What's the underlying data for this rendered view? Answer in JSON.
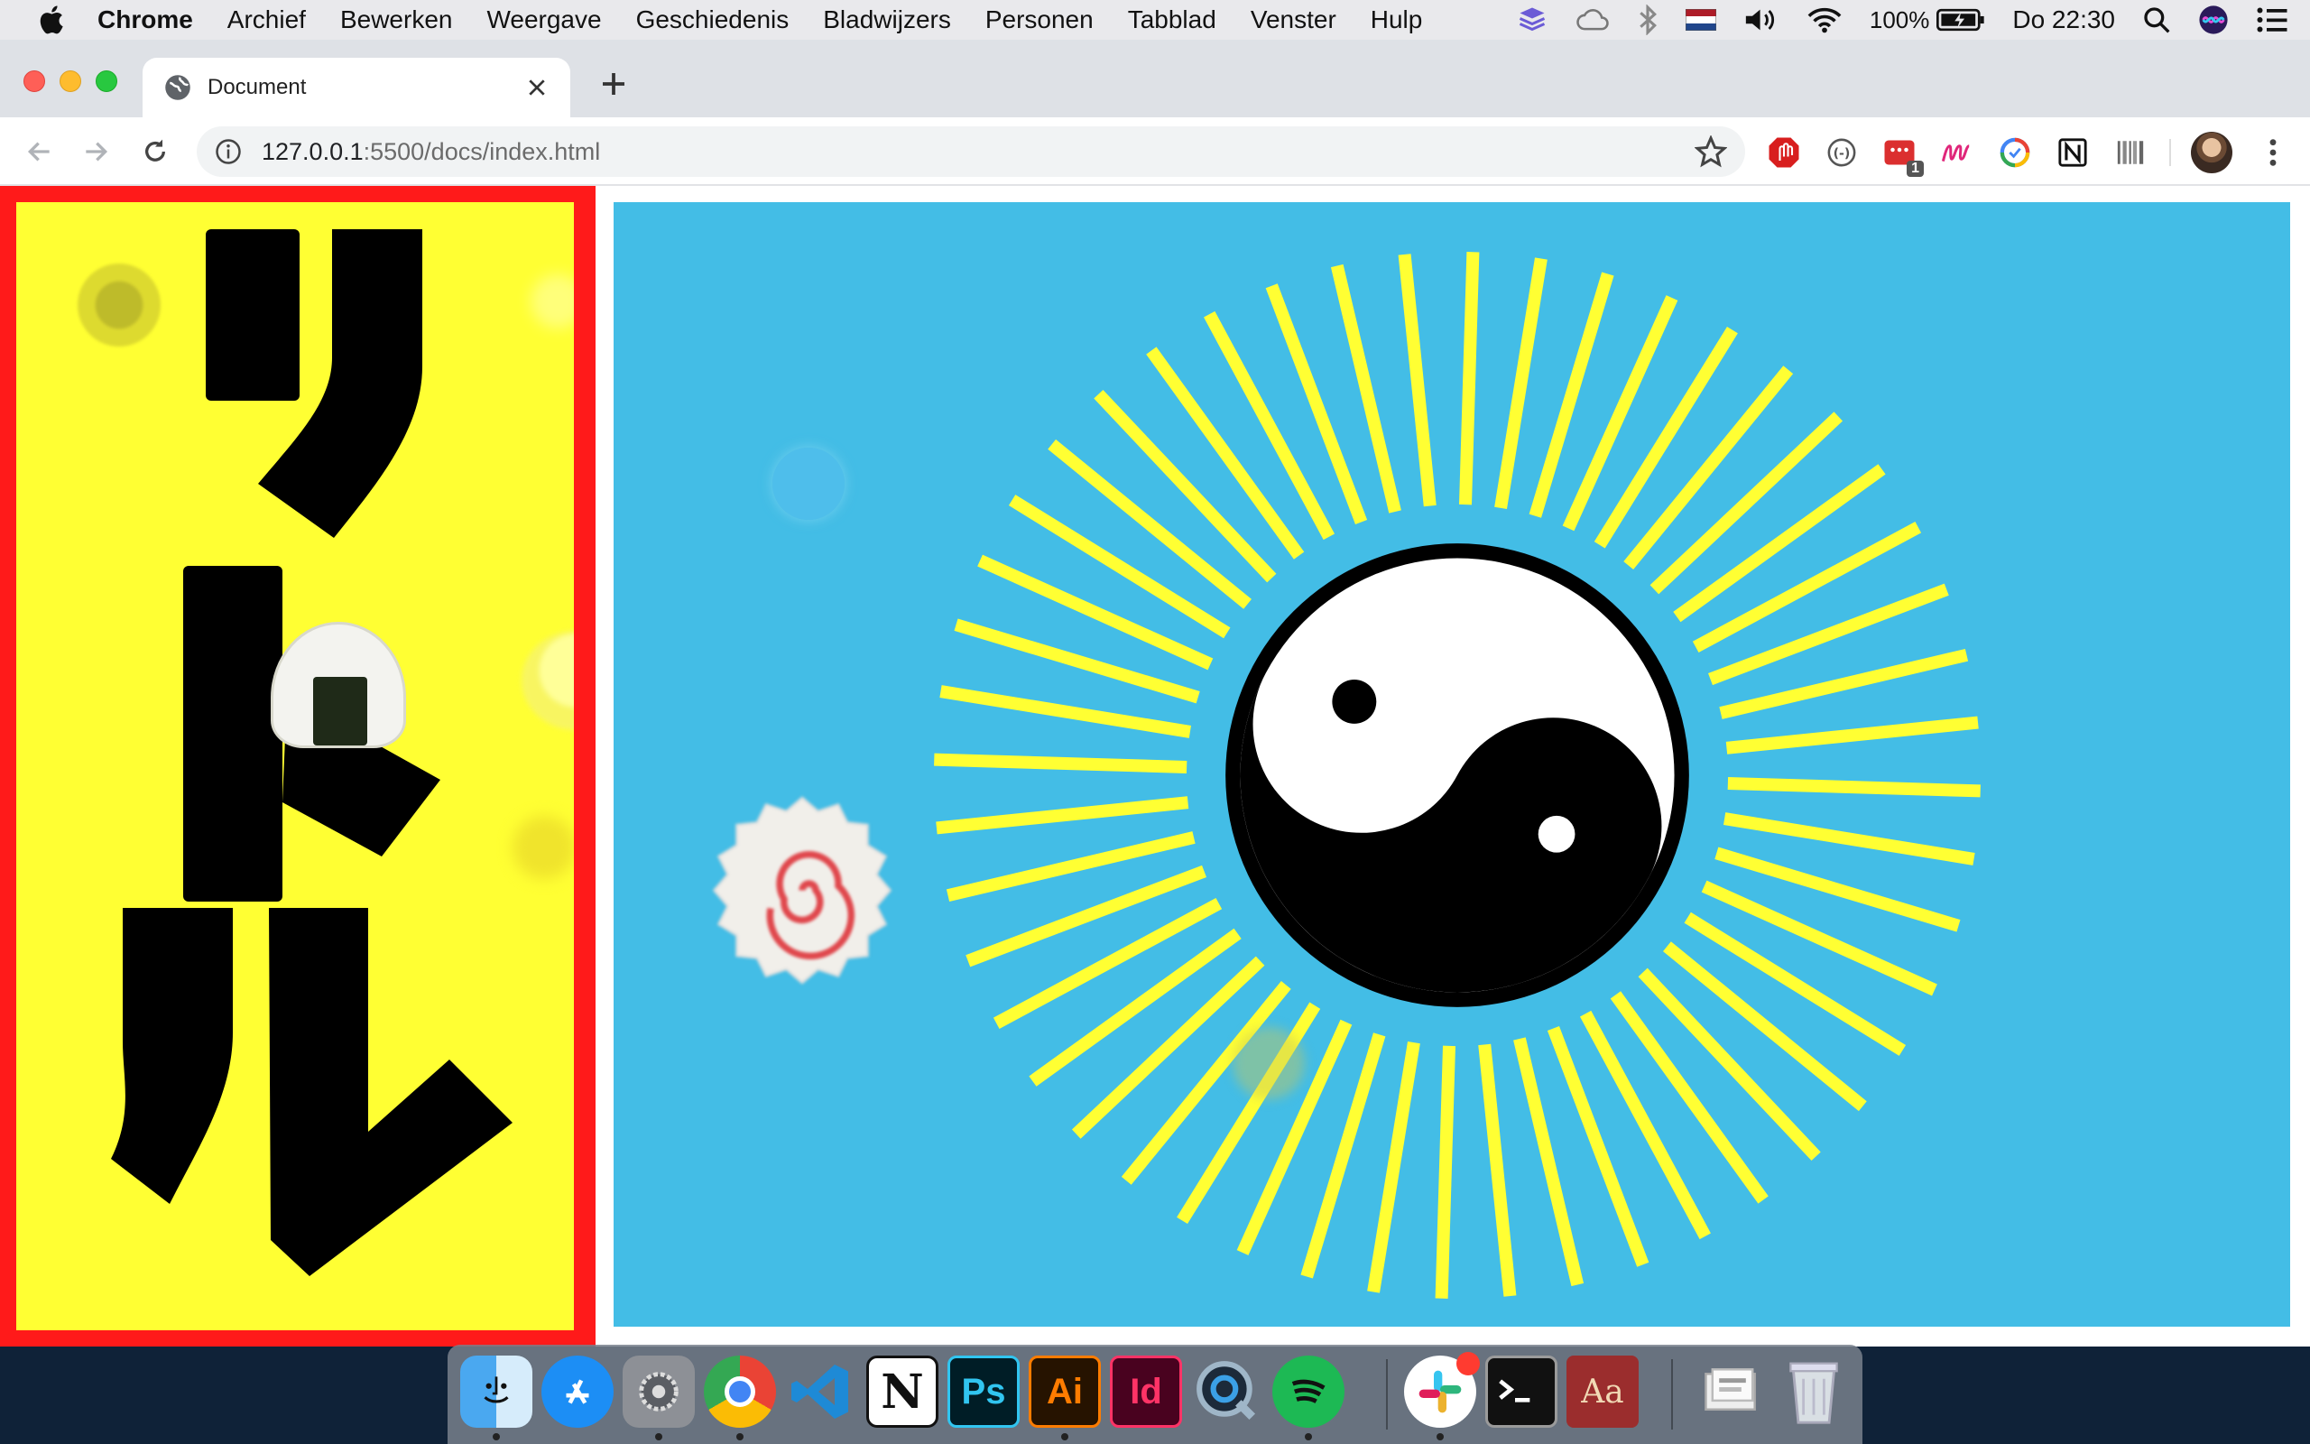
{
  "menubar": {
    "app_name": "Chrome",
    "menus": [
      "Archief",
      "Bewerken",
      "Weergave",
      "Geschiedenis",
      "Bladwijzers",
      "Personen",
      "Tabblad",
      "Venster",
      "Hulp"
    ],
    "battery": "100%",
    "clock": "Do 22:30"
  },
  "browser": {
    "tab_title": "Document",
    "url_host": "127.0.0.1",
    "url_rest": ":5500/docs/index.html",
    "extension_badge": "1"
  },
  "page": {
    "left_panel_glyphs": "リトル",
    "colors": {
      "frame_red": "#ff1a1a",
      "panel_yellow": "#ffff33",
      "sky_blue": "#43bde6",
      "ray_yellow": "#ffff33"
    }
  },
  "dock": {
    "apps": [
      "finder",
      "app-store",
      "system-preferences",
      "chrome",
      "vscode",
      "notion",
      "photoshop",
      "illustrator",
      "indesign",
      "quicktime",
      "spotify",
      "slack",
      "terminal",
      "dictionary",
      "documents",
      "trash"
    ],
    "labels": {
      "photoshop": "Ps",
      "illustrator": "Ai",
      "indesign": "Id",
      "notion": "N",
      "dictionary": "Aa"
    }
  }
}
